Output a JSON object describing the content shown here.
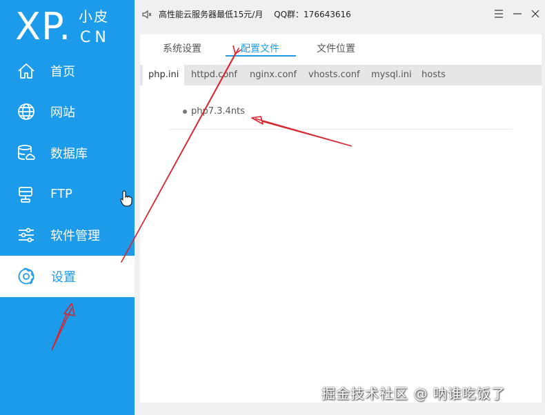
{
  "app": {
    "logo_main": "XP.",
    "logo_top": "小皮",
    "logo_bottom": "CN",
    "accent": "#1c9bea"
  },
  "sidebar": {
    "items": [
      {
        "label": "首页",
        "icon": "home-icon"
      },
      {
        "label": "网站",
        "icon": "globe-icon"
      },
      {
        "label": "数据库",
        "icon": "database-icon"
      },
      {
        "label": "FTP",
        "icon": "ftp-icon"
      },
      {
        "label": "软件管理",
        "icon": "sliders-icon"
      },
      {
        "label": "设置",
        "icon": "gear-icon",
        "active": true
      }
    ]
  },
  "topbar": {
    "notice": "高性能云服务器最低15元/月",
    "qq": "QQ群：176643616"
  },
  "tabs": {
    "primary": [
      "系统设置",
      "配置文件",
      "文件位置"
    ],
    "active_primary": "配置文件",
    "secondary": [
      "php.ini",
      "httpd.conf",
      "nginx.conf",
      "vhosts.conf",
      "mysql.ini",
      "hosts"
    ],
    "active_secondary": "php.ini"
  },
  "content": {
    "items": [
      "php7.3.4nts"
    ]
  },
  "watermark": "掘金技术社区 @ 呐谁吃饭了"
}
